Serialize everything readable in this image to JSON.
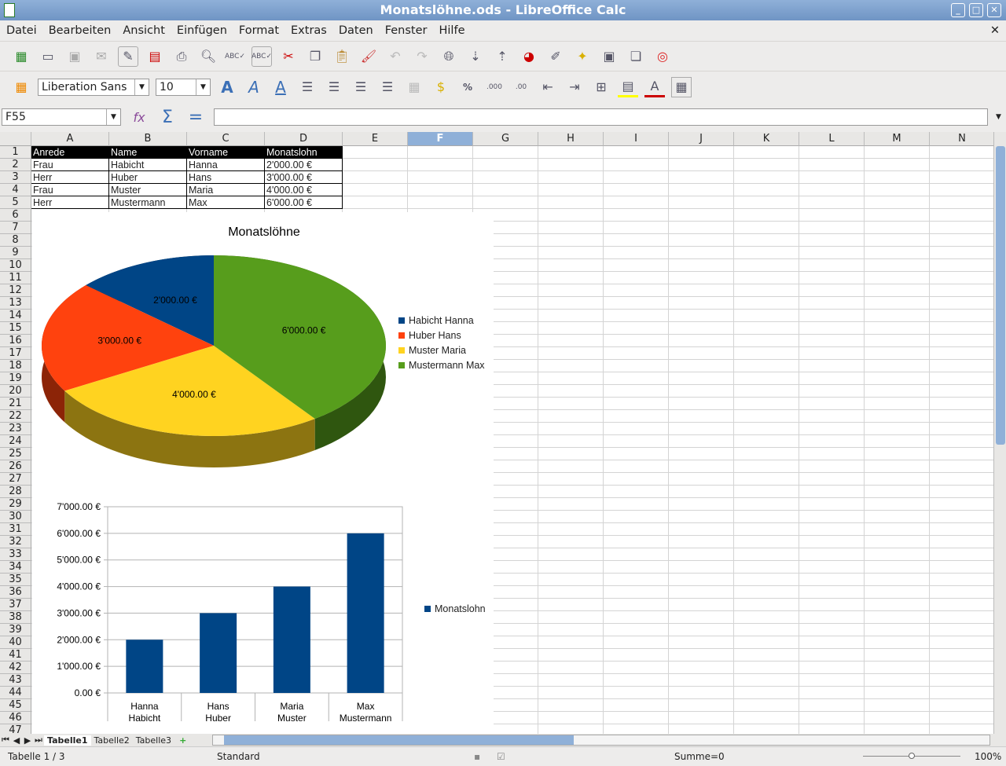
{
  "window": {
    "title": "Monatslöhne.ods - LibreOffice Calc"
  },
  "menu": [
    "Datei",
    "Bearbeiten",
    "Ansicht",
    "Einfügen",
    "Format",
    "Extras",
    "Daten",
    "Fenster",
    "Hilfe"
  ],
  "formatting": {
    "font_name": "Liberation Sans",
    "font_size": "10"
  },
  "formula_bar": {
    "cell_ref": "F55",
    "content": ""
  },
  "columns": [
    "A",
    "B",
    "C",
    "D",
    "E",
    "F",
    "G",
    "H",
    "I",
    "J",
    "K",
    "L",
    "M",
    "N"
  ],
  "selected_column": "F",
  "table": {
    "header": [
      "Anrede",
      "Name",
      "Vorname",
      "Monatslohn"
    ],
    "rows": [
      [
        "Frau",
        "Habicht",
        "Hanna",
        "2'000.00 €"
      ],
      [
        "Herr",
        "Huber",
        "Hans",
        "3'000.00 €"
      ],
      [
        "Frau",
        "Muster",
        "Maria",
        "4'000.00 €"
      ],
      [
        "Herr",
        "Mustermann",
        "Max",
        "6'000.00 €"
      ]
    ]
  },
  "chart_data": [
    {
      "type": "pie",
      "title": "Monatslöhne",
      "three_d": true,
      "legend": "right",
      "categories": [
        "Habicht Hanna",
        "Huber Hans",
        "Muster Maria",
        "Mustermann Max"
      ],
      "values": [
        2000,
        3000,
        4000,
        6000
      ],
      "labels": [
        "2'000.00 €",
        "3'000.00 €",
        "4'000.00 €",
        "6'000.00 €"
      ],
      "colors": [
        "#004586",
        "#ff420e",
        "#ffd320",
        "#579d1c"
      ]
    },
    {
      "type": "bar",
      "legend": "right",
      "grid": true,
      "categories": [
        [
          "Hanna",
          "Habicht"
        ],
        [
          "Hans",
          "Huber"
        ],
        [
          "Maria",
          "Muster"
        ],
        [
          "Max",
          "Mustermann"
        ]
      ],
      "series": [
        {
          "name": "Monatslohn",
          "values": [
            2000,
            3000,
            4000,
            6000
          ],
          "color": "#004586"
        }
      ],
      "ylim": [
        0,
        7000
      ],
      "yticks": [
        "0.00 €",
        "1'000.00 €",
        "2'000.00 €",
        "3'000.00 €",
        "4'000.00 €",
        "5'000.00 €",
        "6'000.00 €",
        "7'000.00 €"
      ]
    }
  ],
  "sheet_tabs": [
    "Tabelle1",
    "Tabelle2",
    "Tabelle3"
  ],
  "active_tab": "Tabelle1",
  "status": {
    "sheet": "Tabelle 1 / 3",
    "style": "Standard",
    "sum": "Summe=0",
    "zoom": "100%"
  }
}
